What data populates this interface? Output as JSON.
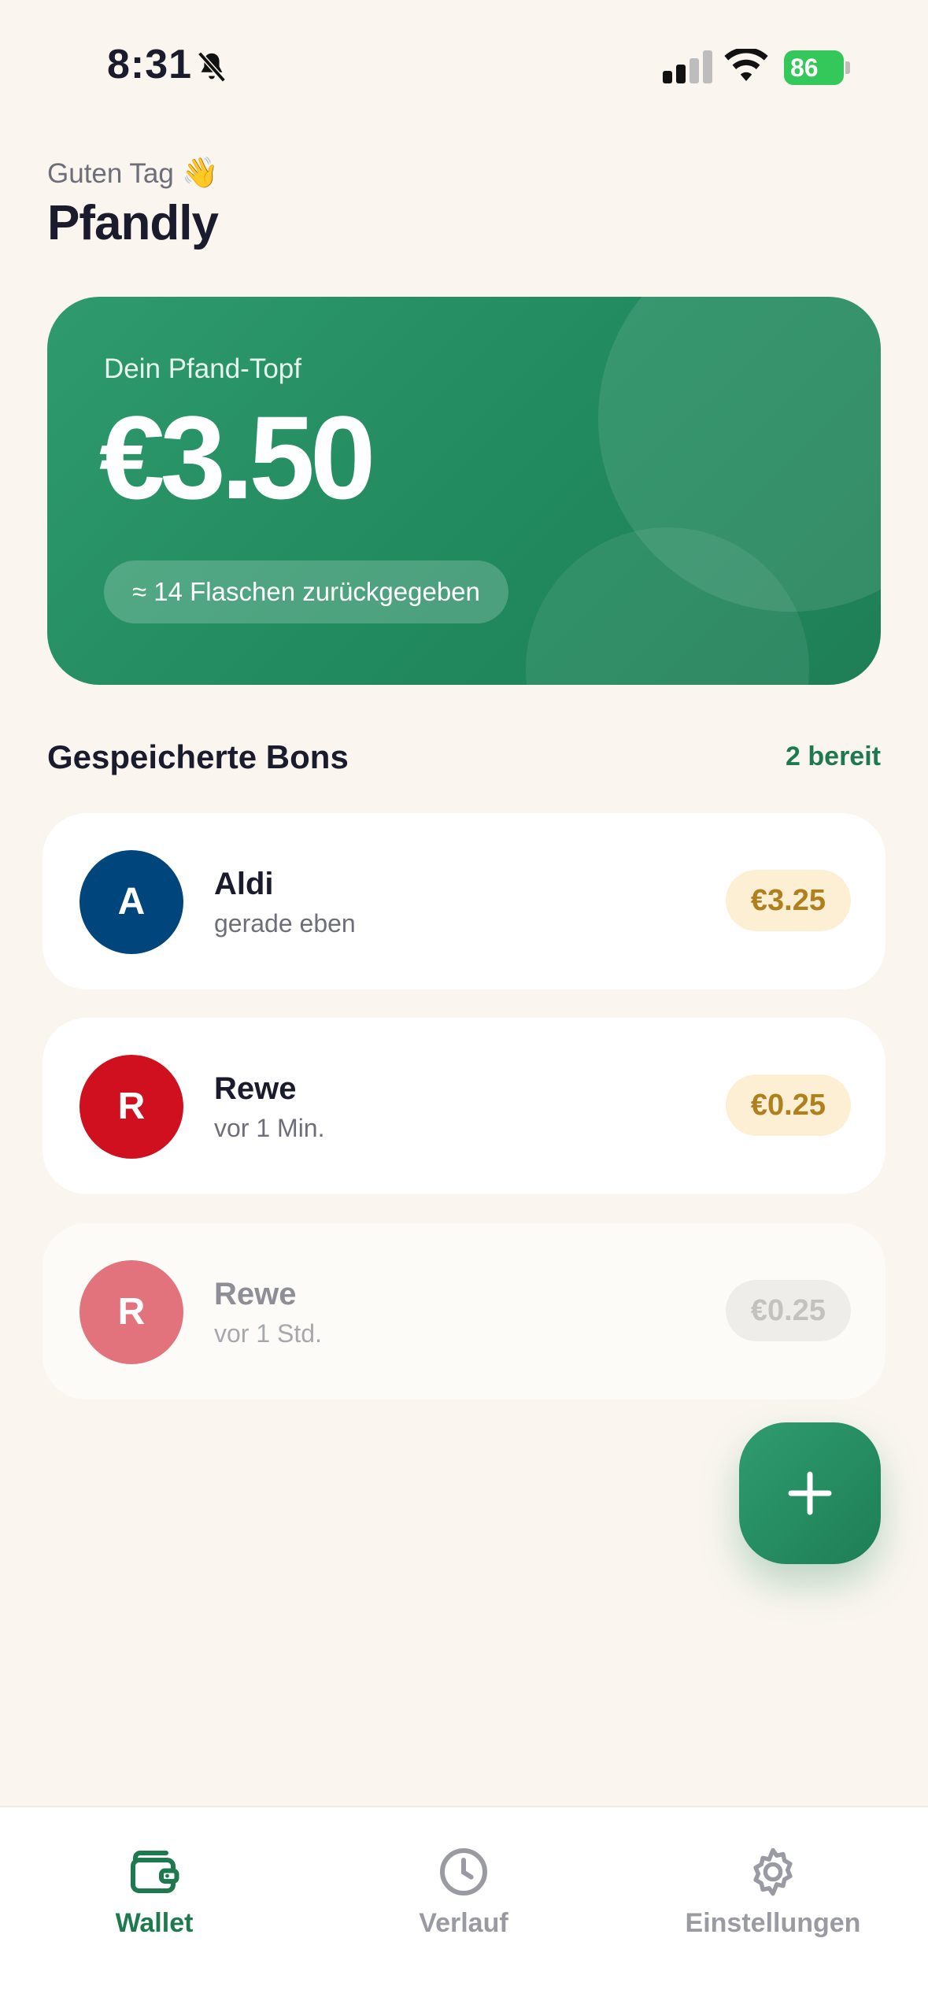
{
  "status_bar": {
    "time": "8:31",
    "battery": "86"
  },
  "header": {
    "greeting": "Guten Tag",
    "greeting_emoji": "👋",
    "title": "Pfandly"
  },
  "balance_card": {
    "label": "Dein Pfand-Topf",
    "amount": "€3.50",
    "bottles_text": "≈ 14 Flaschen zurückgegeben"
  },
  "receipts_section": {
    "title": "Gespeicherte Bons",
    "ready_count": "2 bereit",
    "items": [
      {
        "initial": "A",
        "store": "Aldi",
        "time": "gerade eben",
        "amount": "€3.25",
        "color": "#00457C",
        "state": "ready"
      },
      {
        "initial": "R",
        "store": "Rewe",
        "time": "vor 1 Min.",
        "amount": "€0.25",
        "color": "#D0101E",
        "state": "ready"
      },
      {
        "initial": "R",
        "store": "Rewe",
        "time": "vor 1 Std.",
        "amount": "€0.25",
        "color": "#E2727C",
        "state": "used"
      }
    ]
  },
  "fab": {
    "icon": "plus-icon"
  },
  "tab_bar": {
    "tabs": [
      {
        "label": "Wallet",
        "icon": "wallet-icon",
        "active": true
      },
      {
        "label": "Verlauf",
        "icon": "clock-icon",
        "active": false
      },
      {
        "label": "Einstellungen",
        "icon": "gear-icon",
        "active": false
      }
    ]
  },
  "colors": {
    "background": "#FAF6EF",
    "accent_green": "#1E7A4E",
    "amount_pill_bg": "#FCEFD3",
    "amount_pill_text": "#B07F1E"
  }
}
